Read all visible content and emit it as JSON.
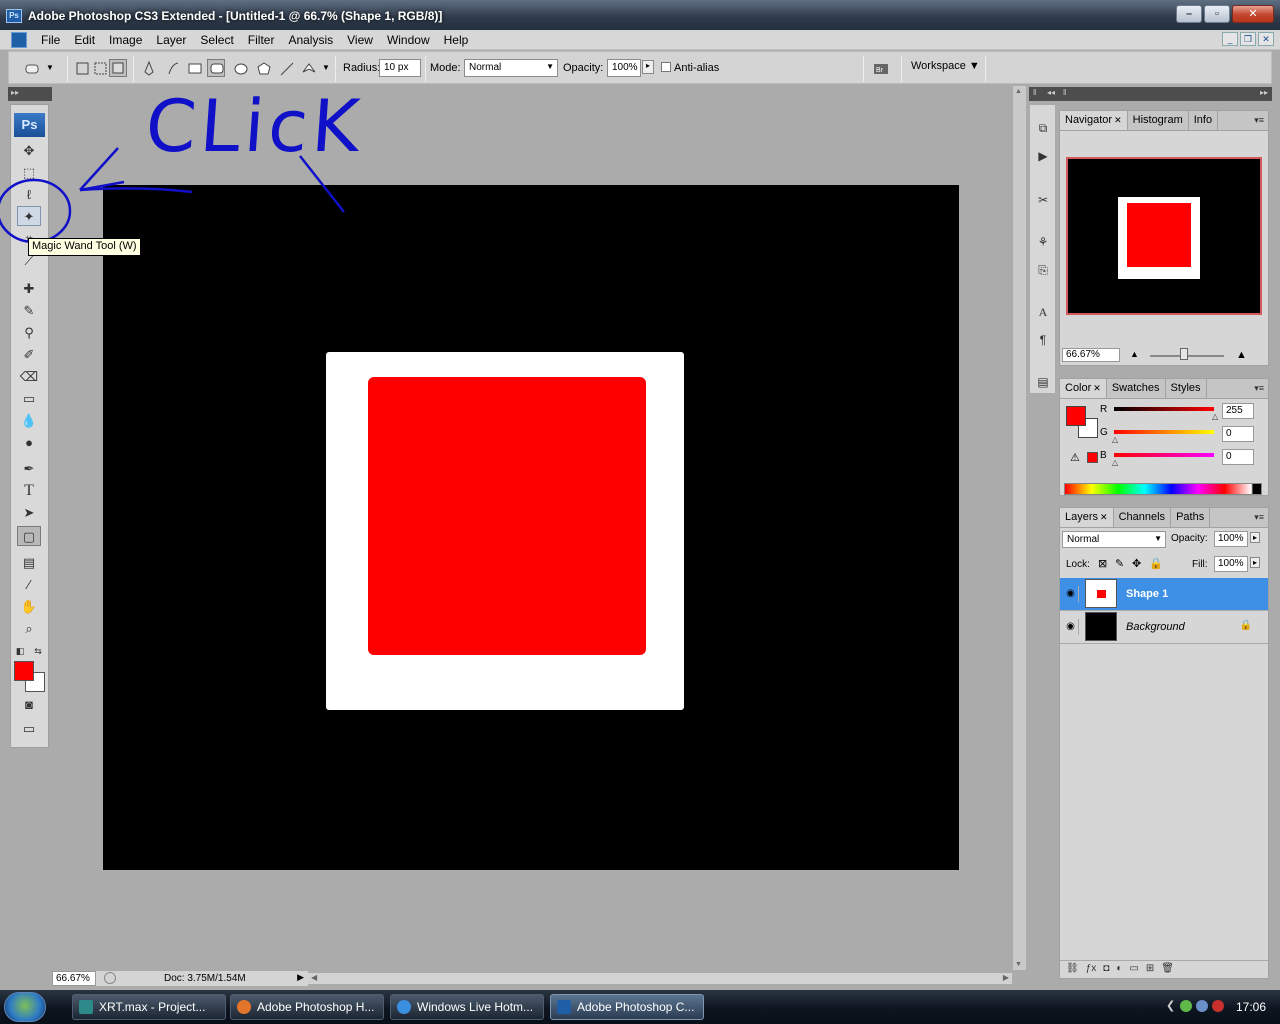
{
  "window": {
    "title": "Adobe Photoshop CS3 Extended - [Untitled-1 @ 66.7% (Shape 1, RGB/8)]",
    "app_icon": "Ps",
    "controls": [
      "minimize",
      "maximize",
      "close"
    ]
  },
  "menu": {
    "items": [
      "File",
      "Edit",
      "Image",
      "Layer",
      "Select",
      "Filter",
      "Analysis",
      "View",
      "Window",
      "Help"
    ]
  },
  "options": {
    "radius_label": "Radius:",
    "radius_value": "10 px",
    "mode_label": "Mode:",
    "mode_value": "Normal",
    "opacity_label": "Opacity:",
    "opacity_value": "100%",
    "antialias_label": "Anti-alias",
    "antialias_checked": false,
    "workspace_label": "Workspace"
  },
  "toolbox": {
    "logo": "Ps",
    "tooltip": "Magic Wand Tool (W)",
    "foreground_color": "#ff0000",
    "background_color": "#ffffff",
    "tools": [
      "move-tool-icon",
      "marquee-tool-icon",
      "lasso-tool-icon",
      "magic-wand-tool-icon",
      "crop-tool-icon",
      "slice-tool-icon",
      "healing-brush-icon",
      "brush-tool-icon",
      "clone-stamp-icon",
      "history-brush-icon",
      "eraser-tool-icon",
      "gradient-tool-icon",
      "blur-tool-icon",
      "dodge-tool-icon",
      "pen-tool-icon",
      "type-tool-icon",
      "path-selection-icon",
      "rounded-rectangle-tool-icon",
      "notes-tool-icon",
      "eyedropper-tool-icon",
      "hand-tool-icon",
      "zoom-tool-icon"
    ]
  },
  "annotation": {
    "text": "CLicK",
    "color": "#1010c8"
  },
  "canvas": {
    "background": "#000000",
    "outer_square": "#ffffff",
    "inner_square": "#ff0000"
  },
  "status": {
    "zoom": "66.67%",
    "doc": "Doc: 3.75M/1.54M"
  },
  "navigator": {
    "tabs": [
      "Navigator",
      "Histogram",
      "Info"
    ],
    "zoom": "66.67%"
  },
  "color_panel": {
    "tabs": [
      "Color",
      "Swatches",
      "Styles"
    ],
    "channels": [
      {
        "label": "R",
        "value": "255"
      },
      {
        "label": "G",
        "value": "0"
      },
      {
        "label": "B",
        "value": "0"
      }
    ]
  },
  "layers_panel": {
    "tabs": [
      "Layers",
      "Channels",
      "Paths"
    ],
    "blend_mode": "Normal",
    "opacity_label": "Opacity:",
    "opacity_value": "100%",
    "lock_label": "Lock:",
    "fill_label": "Fill:",
    "fill_value": "100%",
    "layers": [
      {
        "name": "Shape 1",
        "selected": true
      },
      {
        "name": "Background",
        "selected": false,
        "locked": true
      }
    ]
  },
  "taskbar": {
    "tasks": [
      "XRT.max      - Project...",
      "Adobe Photoshop H...",
      "Windows Live Hotm...",
      "Adobe Photoshop C..."
    ],
    "time": "17:06"
  }
}
